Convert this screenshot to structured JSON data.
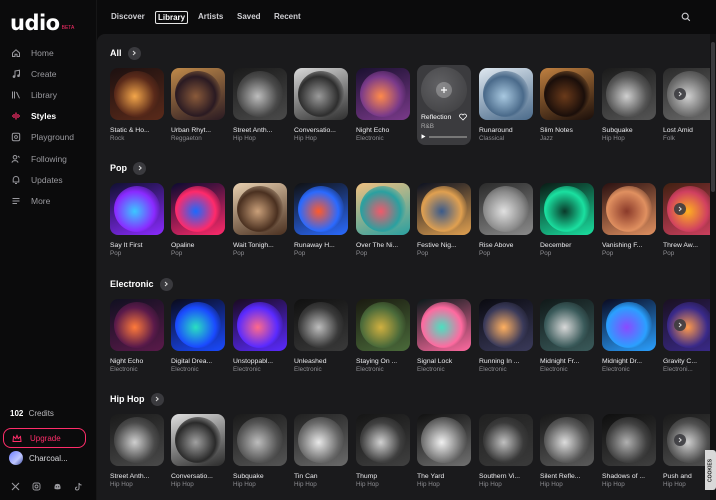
{
  "brand": {
    "name": "udio",
    "version": "BETA"
  },
  "sidebar": {
    "items": [
      {
        "label": "Home",
        "icon": "home-icon"
      },
      {
        "label": "Create",
        "icon": "music-note-icon"
      },
      {
        "label": "Library",
        "icon": "library-icon"
      },
      {
        "label": "Styles",
        "icon": "styles-icon",
        "active": true
      },
      {
        "label": "Playground",
        "icon": "playground-icon"
      },
      {
        "label": "Following",
        "icon": "following-icon"
      },
      {
        "label": "Updates",
        "icon": "bell-icon"
      },
      {
        "label": "More",
        "icon": "menu-icon"
      }
    ],
    "credits_count": "102",
    "credits_label": "Credits",
    "upgrade_label": "Upgrade",
    "user_name": "Charcoal...",
    "socials": [
      "x-icon",
      "instagram-icon",
      "discord-icon",
      "tiktok-icon"
    ]
  },
  "topnav": {
    "tabs": [
      "Discover",
      "Library",
      "Artists",
      "Saved",
      "Recent"
    ],
    "active_tab": "Library"
  },
  "sections": [
    {
      "title": "All",
      "cards": [
        {
          "title": "Static & Ho...",
          "genre": "Rock"
        },
        {
          "title": "Urban Rhyt...",
          "genre": "Reggaeton"
        },
        {
          "title": "Street Anth...",
          "genre": "Hip Hop"
        },
        {
          "title": "Conversatio...",
          "genre": "Hip Hop"
        },
        {
          "title": "Night Echo",
          "genre": "Electronic"
        },
        {
          "title": "Reflection",
          "genre": "R&B",
          "hover": true
        },
        {
          "title": "Runaround",
          "genre": "Classical"
        },
        {
          "title": "Slim Notes",
          "genre": "Jazz"
        },
        {
          "title": "Subquake",
          "genre": "Hip Hop"
        },
        {
          "title": "Lost Amid",
          "genre": "Folk"
        }
      ]
    },
    {
      "title": "Pop",
      "cards": [
        {
          "title": "Say It First",
          "genre": "Pop"
        },
        {
          "title": "Opaline",
          "genre": "Pop"
        },
        {
          "title": "Wait Tonigh...",
          "genre": "Pop"
        },
        {
          "title": "Runaway H...",
          "genre": "Pop"
        },
        {
          "title": "Over The Ni...",
          "genre": "Pop"
        },
        {
          "title": "Festive Nig...",
          "genre": "Pop"
        },
        {
          "title": "Rise Above",
          "genre": "Pop"
        },
        {
          "title": "December",
          "genre": "Pop"
        },
        {
          "title": "Vanishing F...",
          "genre": "Pop"
        },
        {
          "title": "Threw Aw...",
          "genre": "Pop"
        }
      ]
    },
    {
      "title": "Electronic",
      "cards": [
        {
          "title": "Night Echo",
          "genre": "Electronic"
        },
        {
          "title": "Digital Drea...",
          "genre": "Electronic"
        },
        {
          "title": "Unstoppabl...",
          "genre": "Electronic"
        },
        {
          "title": "Unleashed",
          "genre": "Electronic"
        },
        {
          "title": "Staying On ...",
          "genre": "Electronic"
        },
        {
          "title": "Signal Lock",
          "genre": "Electronic"
        },
        {
          "title": "Running In ...",
          "genre": "Electronic"
        },
        {
          "title": "Midnight Fr...",
          "genre": "Electronic"
        },
        {
          "title": "Midnight Dr...",
          "genre": "Electronic"
        },
        {
          "title": "Gravity C...",
          "genre": "Electroni..."
        }
      ]
    },
    {
      "title": "Hip Hop",
      "cards": [
        {
          "title": "Street Anth...",
          "genre": "Hip Hop"
        },
        {
          "title": "Conversatio...",
          "genre": "Hip Hop"
        },
        {
          "title": "Subquake",
          "genre": "Hip Hop"
        },
        {
          "title": "Tin Can",
          "genre": "Hip Hop"
        },
        {
          "title": "Thump",
          "genre": "Hip Hop"
        },
        {
          "title": "The Yard",
          "genre": "Hip Hop"
        },
        {
          "title": "Southern Vi...",
          "genre": "Hip Hop"
        },
        {
          "title": "Silent Refle...",
          "genre": "Hip Hop"
        },
        {
          "title": "Shadows of ...",
          "genre": "Hip Hop"
        },
        {
          "title": "Push and",
          "genre": "Hip Hop"
        }
      ]
    }
  ],
  "cookies_label": "COOKIES",
  "colors": {
    "accent": "#ff2d6a",
    "panel": "#1a1a1c",
    "sidebar": "#0b0b0c"
  }
}
